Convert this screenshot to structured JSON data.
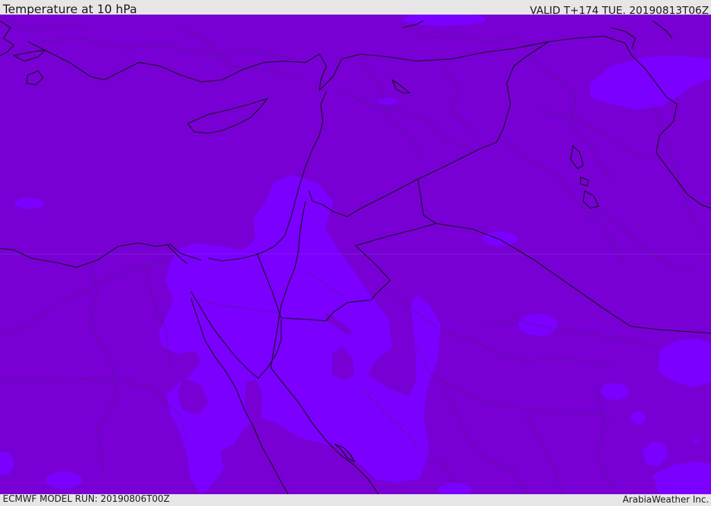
{
  "header": {
    "title": "Temperature at 10 hPa",
    "valid": "VALID T+174 TUE. 20190813T06Z"
  },
  "footer": {
    "model_run": "ECMWF MODEL RUN: 20190806T00Z",
    "credit": "ArabiaWeather Inc."
  },
  "colors": {
    "base_field": "#7800d4",
    "warm_field": "#7b00ff",
    "border_line": "#101010",
    "admin_line": "#303030",
    "bar_background": "#e6e6e6"
  }
}
